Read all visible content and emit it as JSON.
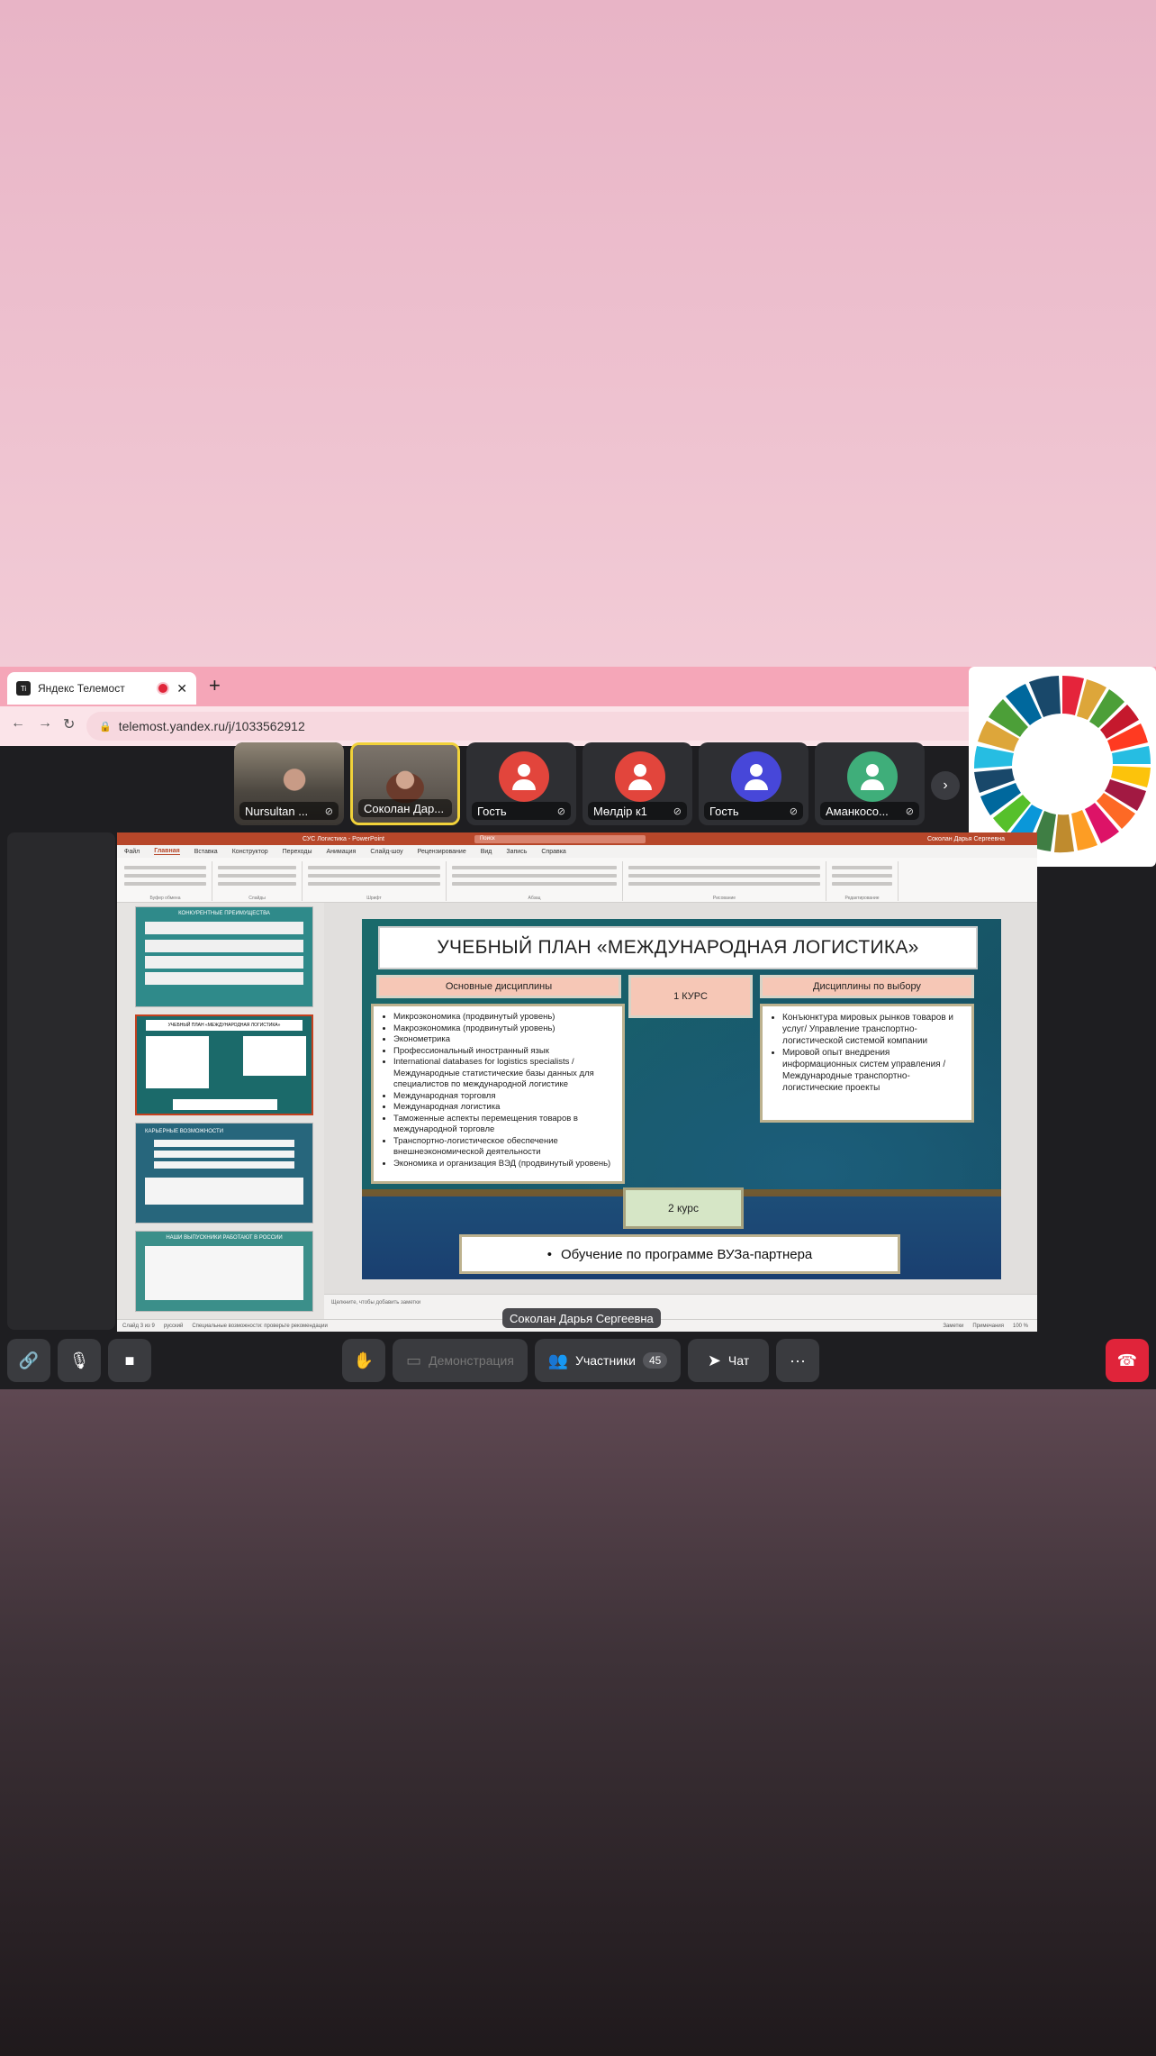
{
  "browser": {
    "tab_title": "Яндекс Телемост",
    "tab_favicon": "Ti",
    "tab_close": "✕",
    "new_tab": "+",
    "url": "telemost.yandex.ru/j/1033562912",
    "nav_back": "←",
    "nav_forward": "→",
    "nav_reload": "↻"
  },
  "participants": [
    {
      "name": "Nursultan ...",
      "type": "video"
    },
    {
      "name": "Соколан Дар...",
      "type": "video",
      "active": true
    },
    {
      "name": "Гость",
      "type": "avatar",
      "color": "#e2453c"
    },
    {
      "name": "Мөлдір к1",
      "type": "avatar",
      "color": "#e2453c"
    },
    {
      "name": "Гость",
      "type": "avatar",
      "color": "#4747d9"
    },
    {
      "name": "Аманкосо...",
      "type": "avatar",
      "color": "#3fae7a"
    }
  ],
  "next_arrow": "›",
  "powerpoint": {
    "title_file": "СУС Логистика - PowerPoint",
    "search": "Поиск",
    "user": "Соколан Дарья Сергеевна",
    "menu": [
      "Файл",
      "Главная",
      "Вставка",
      "Конструктор",
      "Переходы",
      "Анимация",
      "Слайд-шоу",
      "Рецензирование",
      "Вид",
      "Запись",
      "Справка"
    ],
    "ribbon_groups": [
      "Буфер обмена",
      "Слайды",
      "Шрифт",
      "Абзац",
      "Рисование",
      "Редактирование"
    ],
    "notes_placeholder": "Щелкните, чтобы добавить заметки",
    "status": [
      "Слайд 3 из 9",
      "русский",
      "Специальные возможности: проверьте рекомендации",
      "Заметки",
      "Примечания",
      "100 %"
    ],
    "thumb_numbers": [
      "2",
      "3",
      "4",
      "5"
    ],
    "thumb_titles": [
      "КОНКУРЕНТНЫЕ ПРЕИМУЩЕСТВА",
      "УЧЕБНЫЙ ПЛАН «МЕЖДУНАРОДНАЯ ЛОГИСТИКА»",
      "КАРЬЕРНЫЕ ВОЗМОЖНОСТИ",
      "НАШИ ВЫПУСКНИКИ РАБОТАЮТ В РОССИИ"
    ]
  },
  "slide": {
    "title": "УЧЕБНЫЙ ПЛАН «МЕЖДУНАРОДНАЯ ЛОГИСТИКА»",
    "col_main": "Основные дисциплины",
    "col_year1": "1 КУРС",
    "col_elective": "Дисциплины по выбору",
    "main_items": [
      "Микроэкономика (продвинутый уровень)",
      "Макроэкономика (продвинутый уровень)",
      "Эконометрика",
      "Профессиональный иностранный язык",
      "International databases for logistics specialists / Международные статистические базы данных для специалистов по международной логистике",
      "Международная торговля",
      "Международная логистика",
      "Таможенные аспекты перемещения товаров в международной торговле",
      "Транспортно-логистическое обеспечение внешнеэкономической деятельности",
      "Экономика и организация ВЭД (продвинутый уровень)"
    ],
    "elective_items": [
      "Конъюнктура мировых рынков товаров и услуг/ Управление транспортно-логистической системой компании",
      "Мировой опыт внедрения информационных систем управления /Международные транспортно-логистические проекты"
    ],
    "year2": "2 курс",
    "partner": "Обучение по программе ВУЗа-партнера"
  },
  "speaker_label": "Соколан Дарья Сергеевна",
  "toolbar": {
    "demo": "Демонстрация",
    "participants": "Участники",
    "participants_count": "45",
    "chat": "Чат",
    "more": "···"
  },
  "icons": {
    "link": "🔗",
    "mic_off": "🎙",
    "camera": "■",
    "hand": "✋",
    "screen": "▭",
    "people": "👥",
    "chat": "➤",
    "hangup": "☎"
  }
}
